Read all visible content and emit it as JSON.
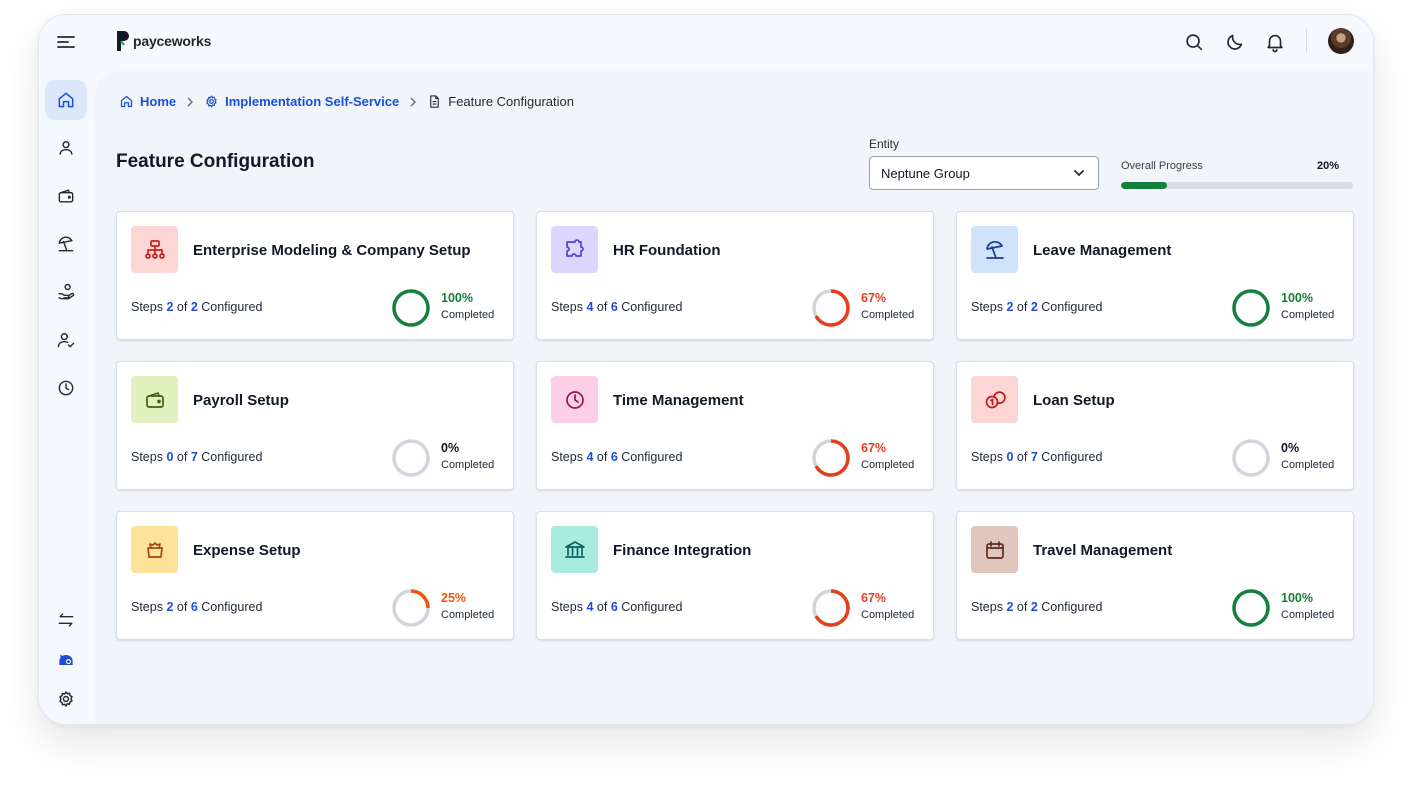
{
  "app": {
    "brand": "payceworks"
  },
  "topbar": {
    "icons": [
      "search-icon",
      "moon-icon",
      "bell-icon"
    ],
    "avatar": "user-avatar"
  },
  "sidebar": {
    "items": [
      {
        "icon": "home-icon",
        "active": true
      },
      {
        "icon": "user-icon"
      },
      {
        "icon": "wallet-icon"
      },
      {
        "icon": "beach-umbrella-icon"
      },
      {
        "icon": "hand-coins-icon"
      },
      {
        "icon": "user-check-icon"
      },
      {
        "icon": "clock-icon"
      }
    ],
    "bottom": [
      {
        "icon": "swap-icon"
      },
      {
        "icon": "mascot-icon"
      },
      {
        "icon": "settings-icon"
      }
    ]
  },
  "breadcrumb": {
    "home": "Home",
    "section": "Implementation Self-Service",
    "current": "Feature Configuration"
  },
  "page": {
    "title": "Feature Configuration"
  },
  "entity": {
    "label": "Entity",
    "value": "Neptune Group"
  },
  "overall_progress": {
    "label": "Overall Progress",
    "value_text": "20%",
    "value": 20
  },
  "colors": {
    "complete": "#15803d",
    "partial": "#e53e1e",
    "partial_low": "#ea580c",
    "empty": "#d1d5db",
    "link": "#1d4ed8"
  },
  "cards": [
    {
      "title": "Enterprise Modeling & Company Setup",
      "icon": "org-chart-icon",
      "icon_bg": "#fcd5d5",
      "icon_color": "#c81e1e",
      "steps_prefix": "Steps",
      "done": "2",
      "of": "of",
      "total": "2",
      "steps_suffix": "Configured",
      "percent_text": "100%",
      "percent": 100,
      "completed_label": "Completed",
      "status_color": "#15803d"
    },
    {
      "title": "HR Foundation",
      "icon": "puzzle-icon",
      "icon_bg": "#ddd6fe",
      "icon_color": "#5b3fd6",
      "steps_prefix": "Steps",
      "done": "4",
      "of": "of",
      "total": "6",
      "steps_suffix": "Configured",
      "percent_text": "67%",
      "percent": 67,
      "completed_label": "Completed",
      "status_color": "#e53e1e"
    },
    {
      "title": "Leave Management",
      "icon": "beach-umbrella-icon",
      "icon_bg": "#cfe3fb",
      "icon_color": "#1e3a8a",
      "steps_prefix": "Steps",
      "done": "2",
      "of": "of",
      "total": "2",
      "steps_suffix": "Configured",
      "percent_text": "100%",
      "percent": 100,
      "completed_label": "Completed",
      "status_color": "#15803d"
    },
    {
      "title": "Payroll Setup",
      "icon": "wallet-icon",
      "icon_bg": "#dff2bf",
      "icon_color": "#3f5f10",
      "steps_prefix": "Steps",
      "done": "0",
      "of": "of",
      "total": "7",
      "steps_suffix": "Configured",
      "percent_text": "0%",
      "percent": 0,
      "completed_label": "Completed",
      "status_color": "#111827"
    },
    {
      "title": "Time Management",
      "icon": "clock-icon",
      "icon_bg": "#fbcfe8",
      "icon_color": "#9d174d",
      "steps_prefix": "Steps",
      "done": "4",
      "of": "of",
      "total": "6",
      "steps_suffix": "Configured",
      "percent_text": "67%",
      "percent": 67,
      "completed_label": "Completed",
      "status_color": "#e53e1e"
    },
    {
      "title": "Loan Setup",
      "icon": "coins-icon",
      "icon_bg": "#fcd5d5",
      "icon_color": "#b91c1c",
      "steps_prefix": "Steps",
      "done": "0",
      "of": "of",
      "total": "7",
      "steps_suffix": "Configured",
      "percent_text": "0%",
      "percent": 0,
      "completed_label": "Completed",
      "status_color": "#111827"
    },
    {
      "title": "Expense Setup",
      "icon": "money-bag-icon",
      "icon_bg": "#fde29a",
      "icon_color": "#a3470b",
      "steps_prefix": "Steps",
      "done": "2",
      "of": "of",
      "total": "6",
      "steps_suffix": "Configured",
      "percent_text": "25%",
      "percent": 25,
      "completed_label": "Completed",
      "status_color": "#ea580c"
    },
    {
      "title": "Finance Integration",
      "icon": "bank-icon",
      "icon_bg": "#a7ecdf",
      "icon_color": "#115e59",
      "steps_prefix": "Steps",
      "done": "4",
      "of": "of",
      "total": "6",
      "steps_suffix": "Configured",
      "percent_text": "67%",
      "percent": 67,
      "completed_label": "Completed",
      "status_color": "#e53e1e"
    },
    {
      "title": "Travel Management",
      "icon": "calendar-icon",
      "icon_bg": "#dfc7bd",
      "icon_color": "#5b2e1f",
      "steps_prefix": "Steps",
      "done": "2",
      "of": "of",
      "total": "2",
      "steps_suffix": "Configured",
      "percent_text": "100%",
      "percent": 100,
      "completed_label": "Completed",
      "status_color": "#15803d"
    }
  ]
}
